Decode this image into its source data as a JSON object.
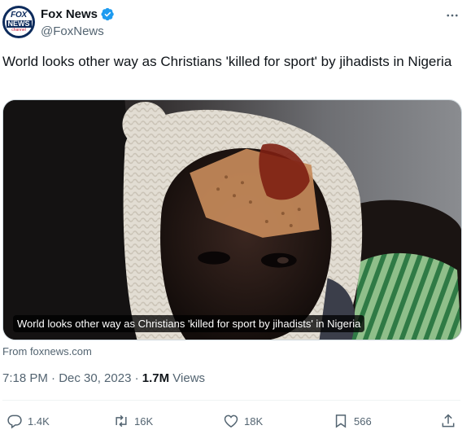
{
  "author": {
    "avatar_logo_top": "FOX",
    "avatar_logo_mid": "NEWS",
    "avatar_logo_bottom": "channel",
    "display_name": "Fox News",
    "handle": "@FoxNews",
    "verified": true
  },
  "tweet": {
    "text": "World looks other way as Christians 'killed for sport' by jihadists in Nigeria",
    "media_caption": "World looks other way as Christians 'killed for sport by jihadists' in Nigeria",
    "source": "From foxnews.com",
    "time": "7:18 PM · Dec 30, 2023 · ",
    "views_count": "1.7M",
    "views_label": " Views"
  },
  "actions": {
    "replies": "1.4K",
    "reposts": "16K",
    "likes": "18K",
    "bookmarks": "566"
  },
  "colors": {
    "verified": "#1d9bf0",
    "secondary_text": "#536471",
    "primary_text": "#0f1419"
  }
}
